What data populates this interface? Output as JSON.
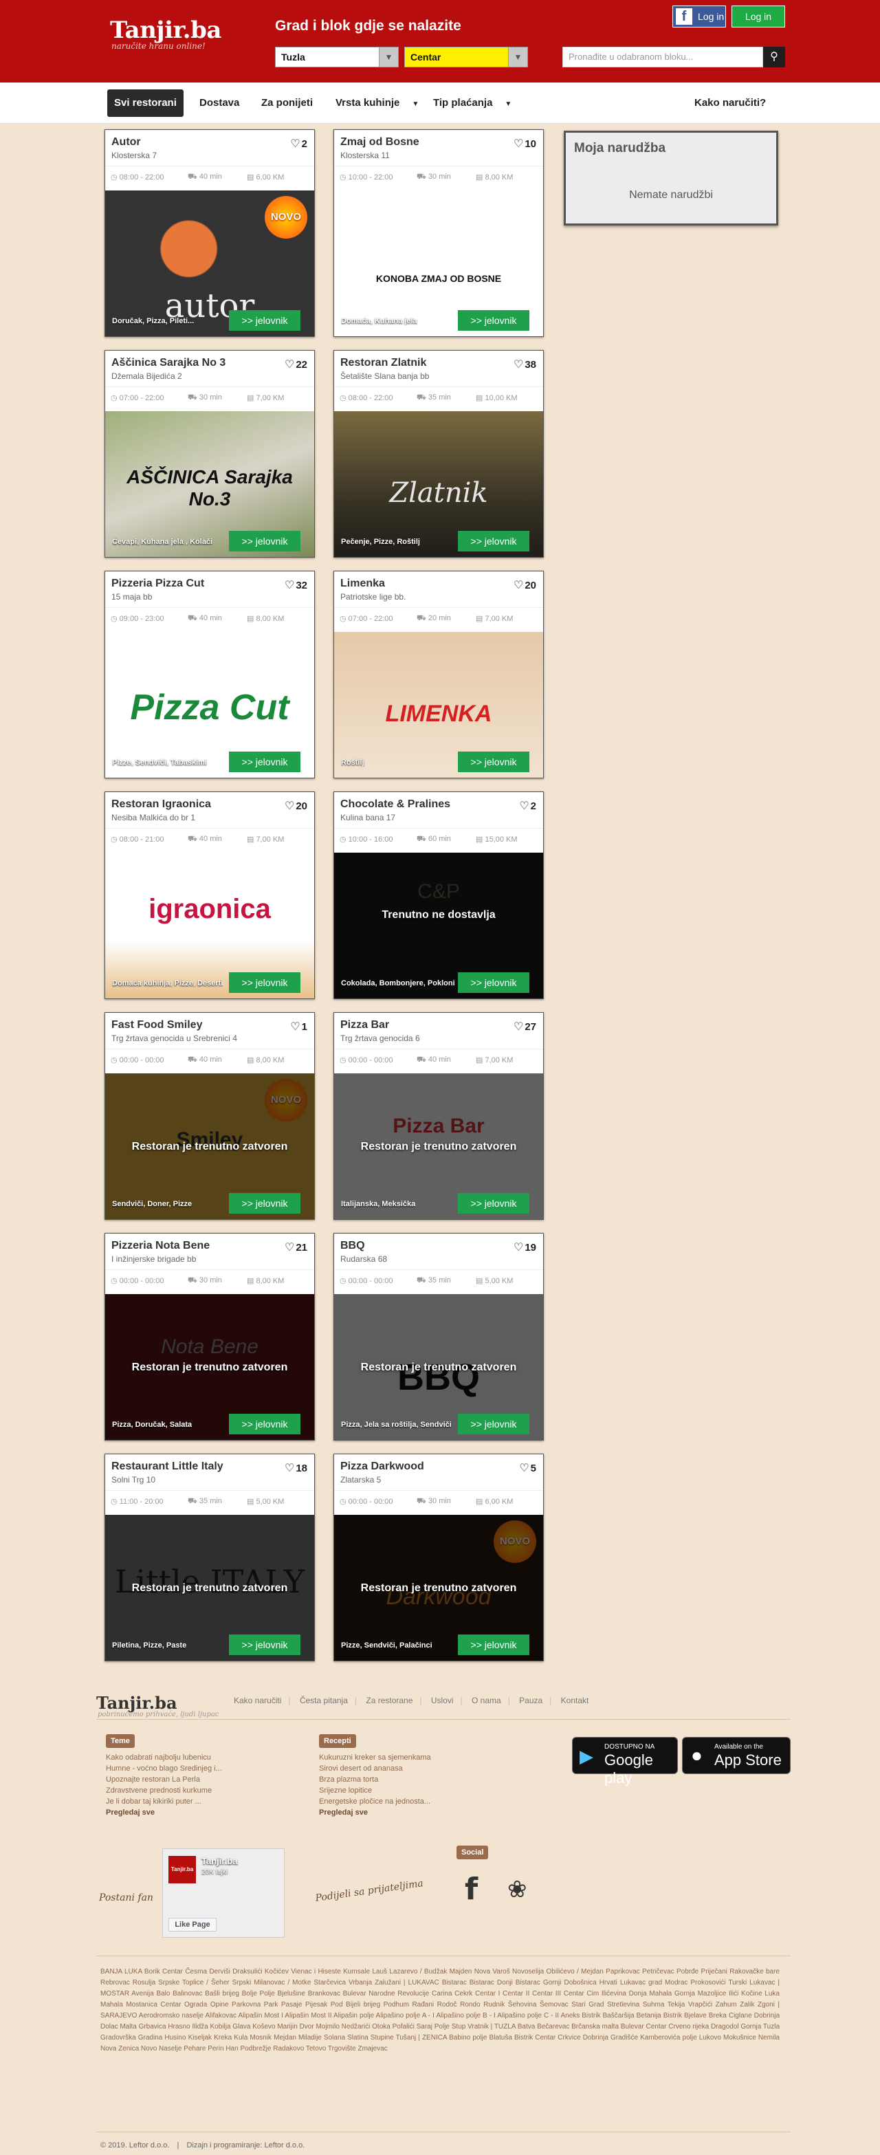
{
  "header": {
    "logo": "Tanjir.ba",
    "tagline": "naručite hranu online!",
    "title": "Grad i blok gdje se nalazite",
    "city": "Tuzla",
    "area": "Centar",
    "search_placeholder": "Pronađite u odabranom bloku...",
    "fb_login": "Log in",
    "login": "Log in"
  },
  "nav": {
    "items": [
      "Svi restorani",
      "Dostava",
      "Za ponijeti",
      "Vrsta kuhinje",
      "Tip plaćanja"
    ],
    "how_to": "Kako naručiti?"
  },
  "order": {
    "title": "Moja narudžba",
    "empty": "Nemate narudžbi"
  },
  "menu_button": ">> jelovnik",
  "restaurants": [
    {
      "name": "Autor",
      "address": "Klosterska 7",
      "likes": "2",
      "hours": "08:00 - 22:00",
      "time": "40 min",
      "min": "6,00 KM",
      "tags": "Doručak, Pizza, Pileti...",
      "status": "",
      "logo": "autor",
      "badge": "NOVO"
    },
    {
      "name": "Zmaj od Bosne",
      "address": "Klosterska 11",
      "likes": "10",
      "hours": "10:00 - 22:00",
      "time": "30 min",
      "min": "8,00 KM",
      "tags": "Domaća, Kuhana jela",
      "status": "",
      "logo": "KONOBA ZMAJ OD BOSNE",
      "badge": ""
    },
    {
      "name": "Aščinica Sarajka No 3",
      "address": "Džemala Bijedića 2",
      "likes": "22",
      "hours": "07:00 - 22:00",
      "time": "30 min",
      "min": "7,00 KM",
      "tags": "Ćevapi, Kuhana jela , Kolači",
      "status": "",
      "logo": "AŠČINICA Sarajka No.3",
      "badge": ""
    },
    {
      "name": "Restoran Zlatnik",
      "address": "Šetalište Slana banja bb",
      "likes": "38",
      "hours": "08:00 - 22:00",
      "time": "35 min",
      "min": "10,00 KM",
      "tags": "Pečenje, Pizze, Roštilj",
      "status": "",
      "logo": "Zlatnik",
      "badge": ""
    },
    {
      "name": "Pizzeria Pizza Cut",
      "address": "15 maja bb",
      "likes": "32",
      "hours": "09:00 - 23:00",
      "time": "40 min",
      "min": "8,00 KM",
      "tags": "Pizze, Sendviči, Tabaskimi",
      "status": "",
      "logo": "Pizza Cut",
      "badge": ""
    },
    {
      "name": "Limenka",
      "address": "Patriotske lige bb.",
      "likes": "20",
      "hours": "07:00 - 22:00",
      "time": "20 min",
      "min": "7,00 KM",
      "tags": "Roštilj",
      "status": "",
      "logo": "LIMENKA",
      "badge": ""
    },
    {
      "name": "Restoran Igraonica",
      "address": "Nesiba Malkića do br 1",
      "likes": "20",
      "hours": "08:00 - 21:00",
      "time": "40 min",
      "min": "7,00 KM",
      "tags": "Domaća kuhinja, Pizze, Deserti",
      "status": "",
      "logo": "igraonica",
      "badge": ""
    },
    {
      "name": "Chocolate & Pralines",
      "address": "Kulina bana 17",
      "likes": "2",
      "hours": "10:00 - 16:00",
      "time": "60 min",
      "min": "15,00 KM",
      "tags": "Cokolada, Bombonjere, Pokloni",
      "status": "Trenutno ne dostavlja",
      "logo": "C&P",
      "badge": ""
    },
    {
      "name": "Fast Food Smiley",
      "address": "Trg žrtava genocida u Srebrenici 4",
      "likes": "1",
      "hours": "00:00 - 00:00",
      "time": "40 min",
      "min": "8,00 KM",
      "tags": "Sendviči, Doner, Pizze",
      "status": "Restoran je trenutno zatvoren",
      "logo": "Smiley",
      "badge": "NOVO"
    },
    {
      "name": "Pizza Bar",
      "address": "Trg žrtava genocida 6",
      "likes": "27",
      "hours": "00:00 - 00:00",
      "time": "40 min",
      "min": "7,00 KM",
      "tags": "Italijanska, Meksička",
      "status": "Restoran je trenutno zatvoren",
      "logo": "Pizza Bar",
      "badge": ""
    },
    {
      "name": "Pizzeria Nota Bene",
      "address": "I inžinjerske brigade bb",
      "likes": "21",
      "hours": "00:00 - 00:00",
      "time": "30 min",
      "min": "8,00 KM",
      "tags": "Pizza, Doručak, Salata",
      "status": "Restoran je trenutno zatvoren",
      "logo": "Nota Bene",
      "badge": ""
    },
    {
      "name": "BBQ",
      "address": "Rudarska 68",
      "likes": "19",
      "hours": "00:00 - 00:00",
      "time": "35 min",
      "min": "5,00 KM",
      "tags": "Pizza, Jela sa roštilja, Sendviči",
      "status": "Restoran je trenutno zatvoren",
      "logo": "BBQ",
      "badge": ""
    },
    {
      "name": "Restaurant Little Italy",
      "address": "Solni Trg 10",
      "likes": "18",
      "hours": "11:00 - 20:00",
      "time": "35 min",
      "min": "5,00 KM",
      "tags": "Piletina, Pizze, Paste",
      "status": "Restoran je trenutno zatvoren",
      "logo": "Little ITALY",
      "badge": ""
    },
    {
      "name": "Pizza Darkwood",
      "address": "Zlatarska 5",
      "likes": "5",
      "hours": "00:00 - 00:00",
      "time": "30 min",
      "min": "6,00 KM",
      "tags": "Pizze, Sendviči, Palačinci",
      "status": "Restoran je trenutno zatvoren",
      "logo": "Darkwood",
      "badge": "NOVO"
    }
  ],
  "footer": {
    "logo": "Tanjir.ba",
    "tagline": "pobrinućemo prihvaće, ljudi ljupac",
    "links": [
      "Kako naručiti",
      "Česta pitanja",
      "Za restorane",
      "Uslovi",
      "O nama",
      "Pauza",
      "Kontakt"
    ],
    "teme_label": "Teme",
    "teme": [
      "Kako odabrati najbolju lubenicu",
      "Humne - voćno blago Sredinjeg i...",
      "Upoznajte restoran La Perla",
      "Zdravstvene prednosti kurkume",
      "Je li dobar taj kikiriki puter ..."
    ],
    "recepti_label": "Recepti",
    "recepti": [
      "Kukuruzni kreker sa sjemenkama",
      "Sirovi desert od ananasa",
      "Brza plazma torta",
      "Srijezne lopitice",
      "Energetske pločice na jednosta..."
    ],
    "more": "Pregledaj sve",
    "google_top": "DOSTUPNO NA",
    "google_main": "Google play",
    "apple_top": "Available on the",
    "apple_main": "App Store",
    "fan_script": "Postani fan",
    "share_script": "Podijeli sa prijateljima",
    "fb_page": "Tanjir.ba",
    "fb_likes": "20K lajki",
    "fb_like_btn": "Like Page",
    "social_label": "Social",
    "cities_text": "BANJA LUKA Borik Centar Česma Derviši Draksulići Kočićev Vienac i Hiseste Kumsale Lauš Lazarevo / Budžak Majden Nova Varoš Novoselija Obilićevo / Mejdan Paprikovac Petričevac Pobrđe Priječani Rakovačke bare Rebrovac Rosulja Srpske Toplice / Šeher Srpski Milanovac / Motke Starčevica Vrbanja Zalužani | LUKAVAC Bistarac Bistarac Donji Bistarac Gornji Dobošnica Hrvati Lukavac grad Modrac Prokosovići Turski Lukavac | MOSTAR Avenija Balo Balinovac Bašli brijeg Bolje Polje Bjelušine Brankovac Bulevar Narodne Revolucije Carina Cekrk Centar I Centar II Centar III Centar Cim Ilićevina Donja Mahala Gornja Mazoljice Ilići Kočine Luka Mahala Mostanica Centar Ograda Opine Parkovna Park Pasaje Pijesak Pod Bijeli brijeg Podhum Rađani Rodoč Rondo Rudnik Šehovina Šemovac Stari Grad Stretlevina Suhma Tekija Vrapčići Zahum Zalik Zgoni | SARAJEVO Aerodromsko naselje Alifakovac Alipašin Most I Alipašin Most II Alipašin polje Alipašino polje A - I Alipašino polje B - I Alipašino polje C - II Aneks Bistrik Baščaršija Betanija Bistrik Bjelave Breka Ciglane Dobrinja Dolac Malta Grbavica Hrasno Ilidža Kobilja Glava Koševo Marijin Dvor Mojmilo Nedžarići Otoka Pofalići Saraj Polje Stup Vratnik | TUZLA Batva Bečarevac Brčanska malta Bulevar Centar Crveno rijeka Dragodol Gornja Tuzla Gradovrška Gradina Husino Kiseljak Kreka Kula Mosnik Mejdan Miladije Solana Slatina Stupine Tušanj | ZENICA Babino polje Blatuša Bistrik Centar Crkvice Dobrinja Gradišće Kamberovića polje Lukovo Mokušnice Nemila Nova Zenica Novo Naselje Pehare Perin Han Podbrežje Radakovo Tetovo Trgovište Zmajevac",
    "copyright": "© 2019. Leftor d.o.o.",
    "credit": "Dizajn i programiranje: Leftor d.o.o."
  }
}
